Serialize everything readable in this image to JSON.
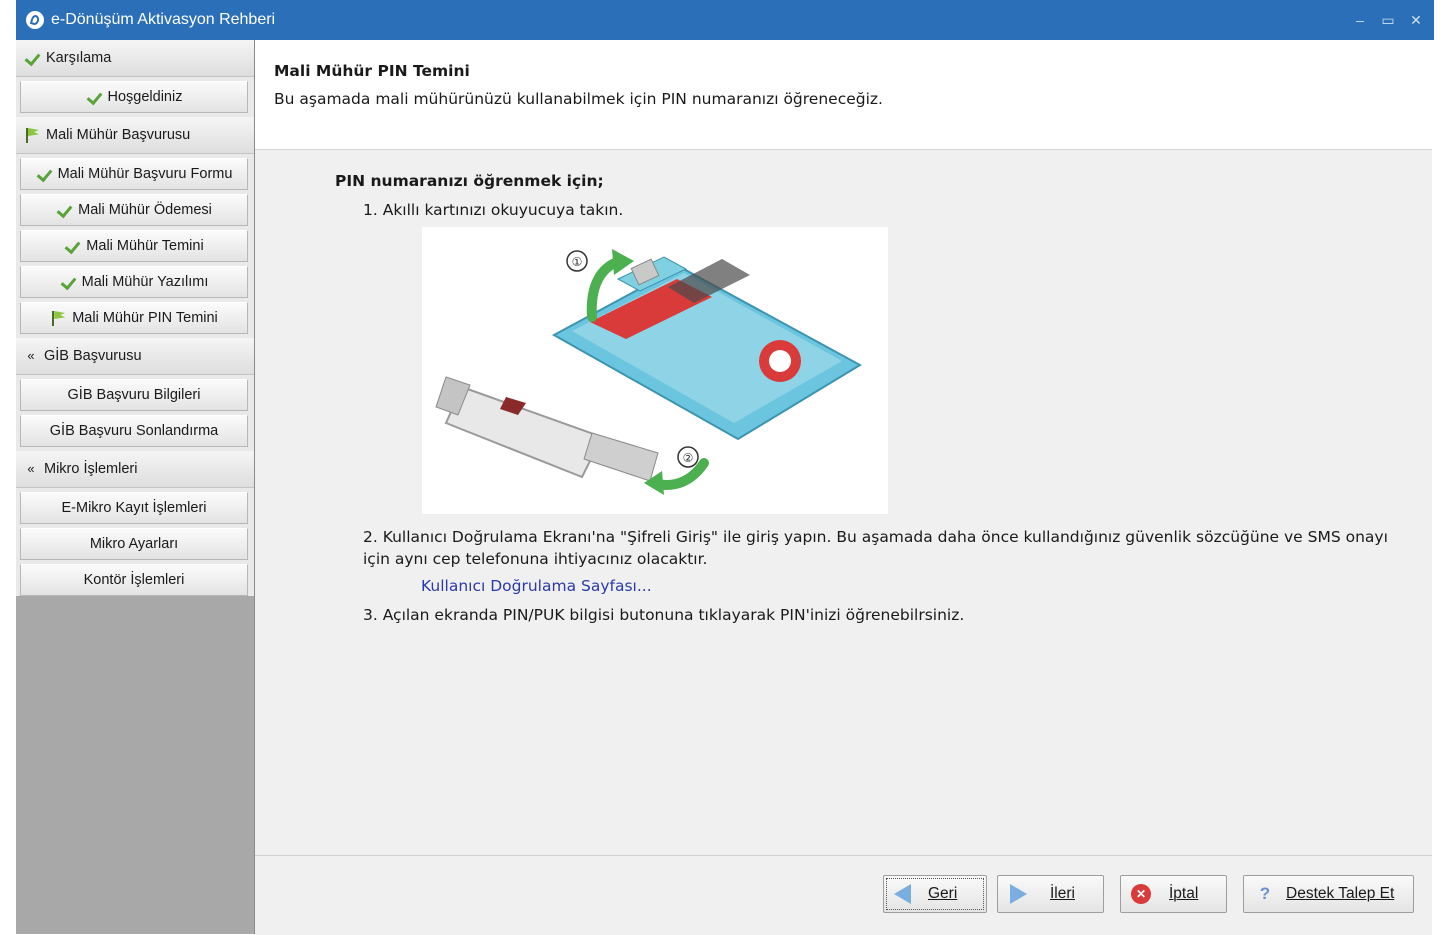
{
  "window": {
    "title": "e-Dönüşüm Aktivasyon Rehberi",
    "controls": [
      "–",
      "▭",
      "✕"
    ]
  },
  "sidebar": {
    "sections": [
      {
        "label": "Karşılama",
        "icon": "check-icon",
        "items": [
          {
            "label": "Hoşgeldiniz",
            "icon": "check-icon"
          }
        ]
      },
      {
        "label": "Mali Mühür Başvurusu",
        "icon": "flag-icon",
        "items": [
          {
            "label": "Mali Mühür Başvuru Formu",
            "icon": "check-icon"
          },
          {
            "label": "Mali Mühür Ödemesi",
            "icon": "check-icon"
          },
          {
            "label": "Mali Mühür Temini",
            "icon": "check-icon"
          },
          {
            "label": "Mali Mühür Yazılımı",
            "icon": "check-icon"
          },
          {
            "label": "Mali Mühür PIN Temini",
            "icon": "flag-icon"
          }
        ]
      },
      {
        "label": "GİB Başvurusu",
        "icon": "chevron-down-icon",
        "items": [
          {
            "label": "GİB Başvuru Bilgileri"
          },
          {
            "label": "GİB Başvuru Sonlandırma"
          }
        ]
      },
      {
        "label": "Mikro İşlemleri",
        "icon": "chevron-down-icon",
        "items": [
          {
            "label": "E-Mikro Kayıt İşlemleri"
          },
          {
            "label": "Mikro Ayarları"
          },
          {
            "label": "Kontör İşlemleri"
          }
        ]
      }
    ]
  },
  "header": {
    "title": "Mali Mühür PIN Temini",
    "subtitle": "Bu aşamada mali mühürünüzü kullanabilmek için PIN numaranızı öğreneceğiz."
  },
  "content": {
    "intro": "PIN numaranızı öğrenmek için;",
    "step1": "1. Akıllı kartınızı okuyucuya takın.",
    "illustration_marks": [
      "①",
      "②"
    ],
    "step2": "2. Kullanıcı Doğrulama Ekranı'na \"Şifreli Giriş\" ile giriş yapın. Bu aşamada daha önce kullandığınız güvenlik sözcüğüne ve SMS onayı için aynı cep telefonuna ihtiyacınız olacaktır.",
    "link": "Kullanıcı Doğrulama Sayfası...",
    "step3": "3. Açılan ekranda PIN/PUK bilgisi butonuna tıklayarak PIN'inizi öğrenebilrsiniz."
  },
  "footer": {
    "back_label": "Geri",
    "next_label": "İleri",
    "cancel_label": "İptal",
    "support_label": "Destek Talep Et"
  },
  "colors": {
    "titlebar": "#2a6fb8",
    "link": "#2a3aa8",
    "check": "#5aa33a",
    "card": "#5bbad5"
  }
}
